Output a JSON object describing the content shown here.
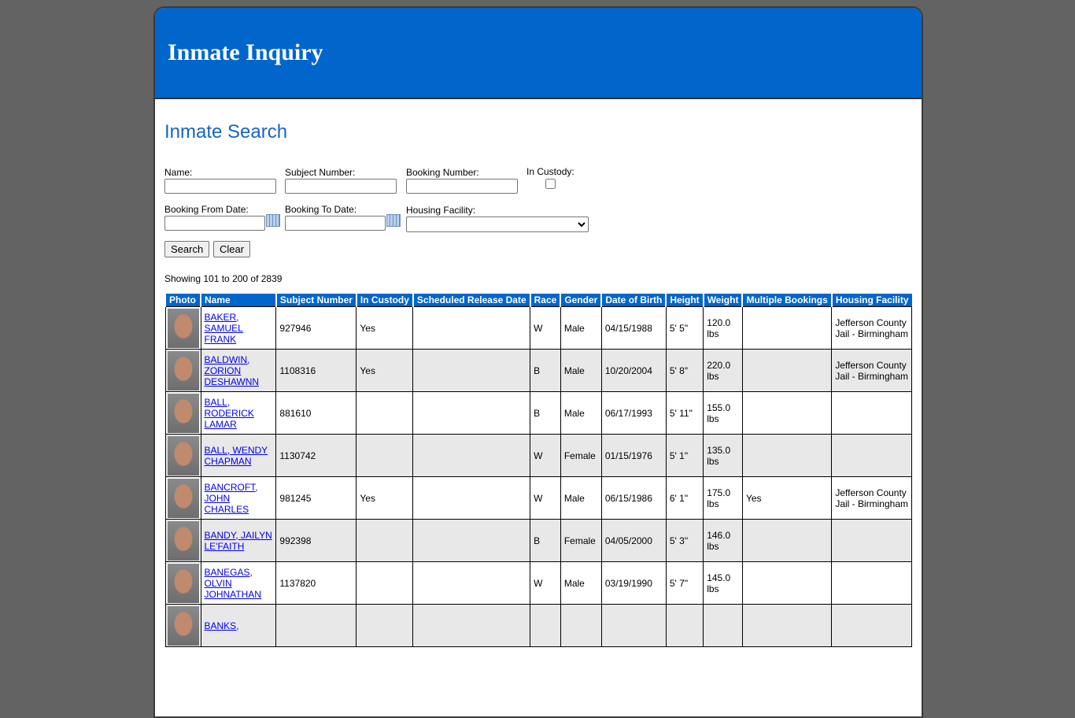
{
  "header": {
    "title": "Inmate Inquiry"
  },
  "search": {
    "title": "Inmate Search",
    "name_label": "Name:",
    "subject_label": "Subject Number:",
    "booking_label": "Booking Number:",
    "custody_label": "In Custody:",
    "from_label": "Booking From Date:",
    "to_label": "Booking To Date:",
    "facility_label": "Housing Facility:",
    "search_btn": "Search",
    "clear_btn": "Clear"
  },
  "results": {
    "showing": "Showing 101 to 200 of 2839",
    "columns": [
      "Photo",
      "Name",
      "Subject Number",
      "In Custody",
      "Scheduled Release Date",
      "Race",
      "Gender",
      "Date of Birth",
      "Height",
      "Weight",
      "Multiple Bookings",
      "Housing Facility"
    ],
    "rows": [
      {
        "name": "BAKER, SAMUEL FRANK",
        "subject": "927946",
        "custody": "Yes",
        "release": "",
        "race": "W",
        "gender": "Male",
        "dob": "04/15/1988",
        "height": "5' 5\"",
        "weight": "120.0 lbs",
        "multiple": "",
        "facility": "Jefferson County Jail - Birmingham"
      },
      {
        "name": "BALDWIN, ZORION DESHAWNN",
        "subject": "1108316",
        "custody": "Yes",
        "release": "",
        "race": "B",
        "gender": "Male",
        "dob": "10/20/2004",
        "height": "5' 8\"",
        "weight": "220.0 lbs",
        "multiple": "",
        "facility": "Jefferson County Jail - Birmingham"
      },
      {
        "name": "BALL, RODERICK LAMAR",
        "subject": "881610",
        "custody": "",
        "release": "",
        "race": "B",
        "gender": "Male",
        "dob": "06/17/1993",
        "height": "5' 11\"",
        "weight": "155.0 lbs",
        "multiple": "",
        "facility": ""
      },
      {
        "name": "BALL, WENDY CHAPMAN",
        "subject": "1130742",
        "custody": "",
        "release": "",
        "race": "W",
        "gender": "Female",
        "dob": "01/15/1976",
        "height": "5' 1\"",
        "weight": "135.0 lbs",
        "multiple": "",
        "facility": ""
      },
      {
        "name": "BANCROFT, JOHN CHARLES",
        "subject": "981245",
        "custody": "Yes",
        "release": "",
        "race": "W",
        "gender": "Male",
        "dob": "06/15/1986",
        "height": "6' 1\"",
        "weight": "175.0 lbs",
        "multiple": "Yes",
        "facility": "Jefferson County Jail - Birmingham"
      },
      {
        "name": "BANDY, JAILYN LE'FAITH",
        "subject": "992398",
        "custody": "",
        "release": "",
        "race": "B",
        "gender": "Female",
        "dob": "04/05/2000",
        "height": "5' 3\"",
        "weight": "146.0 lbs",
        "multiple": "",
        "facility": ""
      },
      {
        "name": "BANEGAS, OLVIN JOHNATHAN",
        "subject": "1137820",
        "custody": "",
        "release": "",
        "race": "W",
        "gender": "Male",
        "dob": "03/19/1990",
        "height": "5' 7\"",
        "weight": "145.0 lbs",
        "multiple": "",
        "facility": ""
      },
      {
        "name": "BANKS,",
        "subject": "",
        "custody": "",
        "release": "",
        "race": "",
        "gender": "",
        "dob": "",
        "height": "",
        "weight": "",
        "multiple": "",
        "facility": ""
      }
    ]
  }
}
